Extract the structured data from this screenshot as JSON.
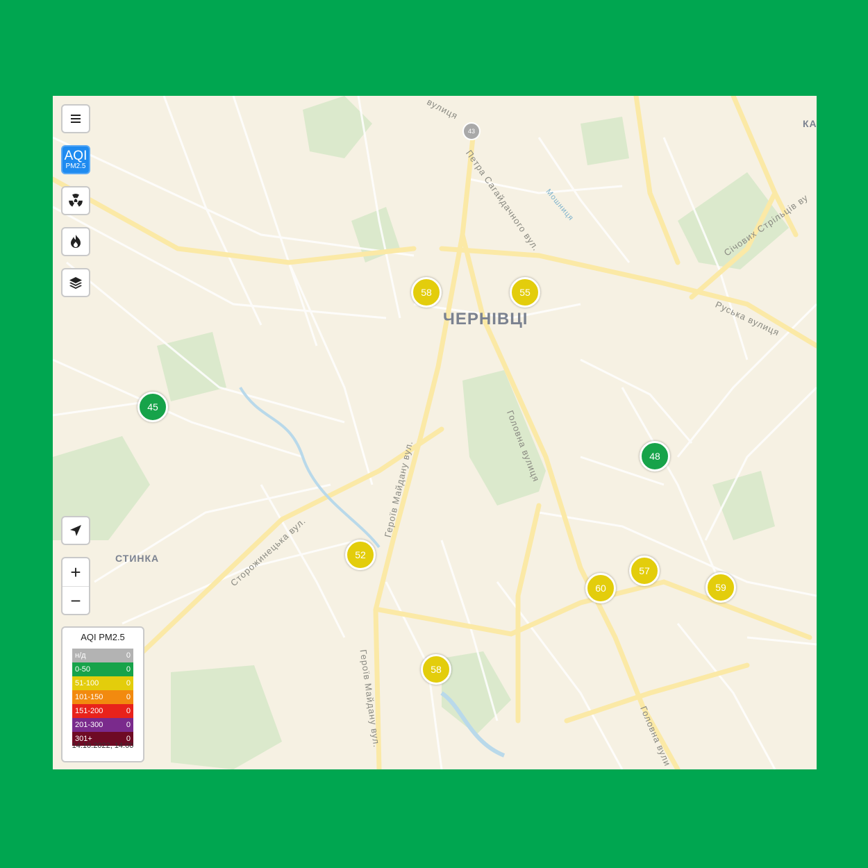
{
  "map": {
    "city_label": "ЧЕРНІВЦІ",
    "district_label": "СТИНКА",
    "partial_label": "КА",
    "route_shield": "43",
    "streets": [
      {
        "id": "vulytsia",
        "text": "вулиця"
      },
      {
        "id": "sahaidachnoho",
        "text": "Петра Сагайдачного вул."
      },
      {
        "id": "mosh",
        "text": "Мошниця"
      },
      {
        "id": "sichovykh",
        "text": "Січових Стрільців ву"
      },
      {
        "id": "ruska",
        "text": "Руська вулиця"
      },
      {
        "id": "holovna1",
        "text": "Головна вулиця"
      },
      {
        "id": "holovna2",
        "text": "Головна вули"
      },
      {
        "id": "heroiv1",
        "text": "Героїв Майдану вул."
      },
      {
        "id": "heroiv2",
        "text": "Героїв Майдану вул."
      },
      {
        "id": "storozh",
        "text": "Сторожинецька вул."
      }
    ]
  },
  "controls": {
    "menu_icon": "menu-icon",
    "aqi_main": "AQI",
    "aqi_sub": "PM2.5",
    "radiation_icon": "radiation-icon",
    "fire_icon": "fire-icon",
    "layers_icon": "layers-icon",
    "locate_icon": "locate-arrow-icon",
    "zoom_in": "+",
    "zoom_out": "−"
  },
  "markers": [
    {
      "value": "58",
      "level": "moderate"
    },
    {
      "value": "55",
      "level": "moderate"
    },
    {
      "value": "45",
      "level": "good"
    },
    {
      "value": "48",
      "level": "good"
    },
    {
      "value": "52",
      "level": "moderate"
    },
    {
      "value": "57",
      "level": "moderate"
    },
    {
      "value": "60",
      "level": "moderate"
    },
    {
      "value": "59",
      "level": "moderate"
    },
    {
      "value": "58",
      "level": "moderate"
    }
  ],
  "legend": {
    "title": "AQI PM2.5",
    "rows": [
      {
        "label": "н/д",
        "count": "0",
        "color": "#b3b3b3"
      },
      {
        "label": "0-50",
        "count": "0",
        "color": "#17a34a"
      },
      {
        "label": "51-100",
        "count": "0",
        "color": "#e3cd0c"
      },
      {
        "label": "101-150",
        "count": "0",
        "color": "#f28a0f"
      },
      {
        "label": "151-200",
        "count": "0",
        "color": "#e8221b"
      },
      {
        "label": "201-300",
        "count": "0",
        "color": "#7a2a8c"
      },
      {
        "label": "301+",
        "count": "0",
        "color": "#6e0a24"
      }
    ],
    "timestamp": "14.10.2022, 14:00"
  },
  "colors": {
    "frame": "#00a650",
    "good": "#17a34a",
    "moderate": "#e3cd0c",
    "active_button": "#1f8bf0"
  }
}
